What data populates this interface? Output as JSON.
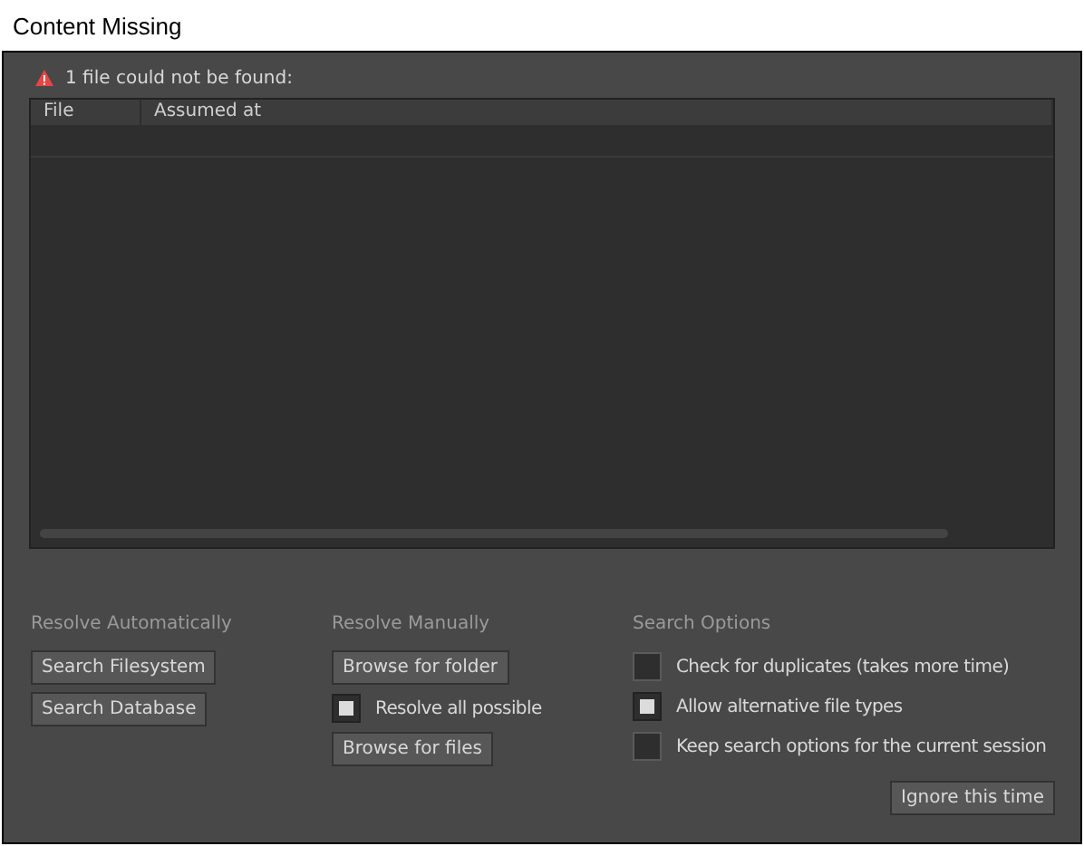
{
  "window": {
    "title": "Content Missing"
  },
  "message": "1 file could not be found:",
  "table": {
    "columns": [
      "File",
      "Assumed at"
    ]
  },
  "sections": [
    {
      "title": "Resolve Automatically",
      "items": [
        {
          "kind": "button",
          "label": "Search Filesystem"
        },
        {
          "kind": "button",
          "label": "Search Database"
        }
      ]
    },
    {
      "title": "Resolve Manually",
      "items": [
        {
          "kind": "button",
          "label": "Browse for folder"
        },
        {
          "kind": "checkbox",
          "label": "Resolve all possible",
          "checked": true
        },
        {
          "kind": "button",
          "label": "Browse for files"
        }
      ]
    },
    {
      "title": "Search Options",
      "items": [
        {
          "kind": "checkbox",
          "label": "Check for duplicates (takes more time)",
          "checked": false
        },
        {
          "kind": "checkbox",
          "label": "Allow alternative file types",
          "checked": true
        },
        {
          "kind": "checkbox",
          "label": "Keep search options for the current session",
          "checked": false
        }
      ]
    }
  ],
  "footer_button": "Ignore this time"
}
